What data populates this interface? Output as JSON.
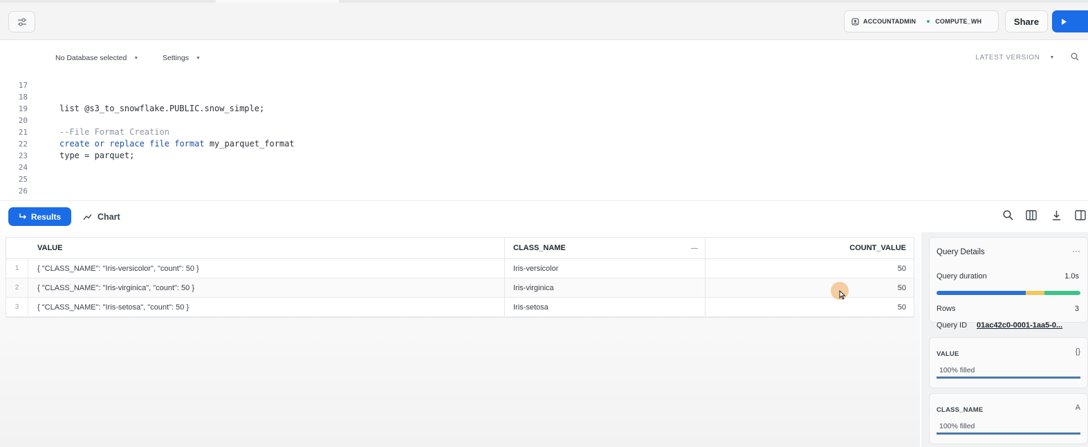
{
  "topbar": {
    "role": "ACCOUNTADMIN",
    "warehouse": "COMPUTE_WH",
    "share_label": "Share"
  },
  "editor_toolbar": {
    "database": "No Database selected",
    "settings": "Settings",
    "version": "LATEST VERSION"
  },
  "editor": {
    "lines": [
      {
        "num": "17",
        "text": ""
      },
      {
        "num": "18",
        "text": ""
      },
      {
        "num": "19",
        "text": "list @s3_to_snowflake.PUBLIC.snow_simple;"
      },
      {
        "num": "20",
        "text": ""
      },
      {
        "num": "21",
        "text": "--File Format Creation"
      },
      {
        "num": "22",
        "text": "create or replace file format my_parquet_format"
      },
      {
        "num": "23",
        "text": "type = parquet;"
      },
      {
        "num": "24",
        "text": ""
      },
      {
        "num": "25",
        "text": ""
      },
      {
        "num": "26",
        "text": ""
      }
    ]
  },
  "results_bar": {
    "results_label": "Results",
    "chart_label": "Chart"
  },
  "grid": {
    "columns": [
      "VALUE",
      "CLASS_NAME",
      "COUNT_VALUE"
    ],
    "rows": [
      {
        "idx": "1",
        "value": "{   \"CLASS_NAME\": \"Iris-versicolor\",   \"count\": 50 }",
        "class_name": "Iris-versicolor",
        "count": "50"
      },
      {
        "idx": "2",
        "value": "{   \"CLASS_NAME\": \"Iris-virginica\",   \"count\": 50 }",
        "class_name": "Iris-virginica",
        "count": "50"
      },
      {
        "idx": "3",
        "value": "{   \"CLASS_NAME\": \"Iris-setosa\",   \"count\": 50 }",
        "class_name": "Iris-setosa",
        "count": "50"
      }
    ]
  },
  "query_details": {
    "title": "Query Details",
    "duration_label": "Query duration",
    "duration_value": "1.0s",
    "rows_label": "Rows",
    "rows_value": "3",
    "qid_label": "Query ID",
    "qid_value": "01ac42c0-0001-1aa5-0..."
  },
  "column_cards": [
    {
      "name": "VALUE",
      "filled": "100% filled",
      "fill_fraction": 1.0
    },
    {
      "name": "CLASS_NAME",
      "filled": "100% filled",
      "fill_fraction": 1.0
    }
  ],
  "colors": {
    "accent": "#1a6ce7",
    "duration_blue": "#2a72d6",
    "duration_yellow": "#f0c75a",
    "duration_green": "#3cc48a",
    "running_dot": "#29b586"
  }
}
